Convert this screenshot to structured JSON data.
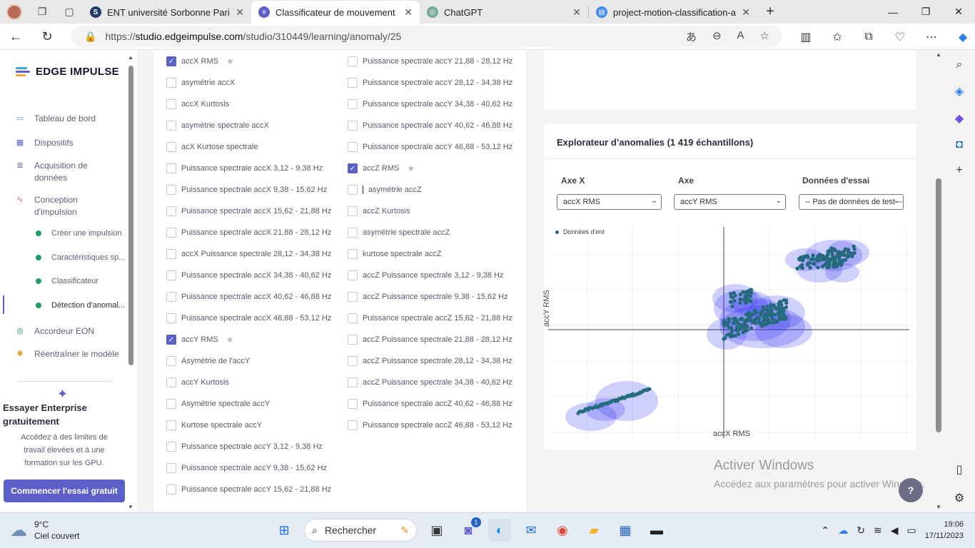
{
  "browser": {
    "tabs": [
      {
        "title": "ENT université Sorbonne Paris No",
        "favicon": "S",
        "color": "#1f3a66",
        "active": false
      },
      {
        "title": "Classificateur de mouvement ind",
        "favicon": "≡",
        "color": "#5b5fc7",
        "active": true
      },
      {
        "title": "ChatGPT",
        "favicon": "◎",
        "color": "#74aa9c",
        "active": false
      },
      {
        "title": "project-motion-classification-anc",
        "favicon": "▤",
        "color": "#4285f4",
        "active": false
      }
    ],
    "close_glyph": "✕",
    "new_tab_glyph": "+",
    "url_prefix": "https://",
    "url_host": "studio.edgeimpulse.com",
    "url_path": "/studio/310449/learning/anomaly/25"
  },
  "sidebar": {
    "brand": "EDGE IMPULSE",
    "nav": [
      {
        "label": "Tableau de bord",
        "icon": "monitor-icon",
        "glyph": "▭",
        "color": "#3aa6d8"
      },
      {
        "label": "Dispositifs",
        "icon": "chip-icon",
        "glyph": "▦",
        "color": "#5b5fc7"
      },
      {
        "label": "Acquisition de données",
        "icon": "database-icon",
        "glyph": "≣",
        "color": "#5b5fc7"
      },
      {
        "label": "Conception d'impulsion",
        "icon": "pulse-icon",
        "glyph": "∿",
        "color": "#e2554b"
      }
    ],
    "sub": [
      {
        "label": "Créer une impulsion"
      },
      {
        "label": "Caractéristiques sp..."
      },
      {
        "label": "Classificateur"
      },
      {
        "label": "Détection d'anomal..."
      }
    ],
    "nav2": [
      {
        "label": "Accordeur EON",
        "icon": "tuner-icon",
        "glyph": "◎",
        "color": "#1f9e63"
      },
      {
        "label": "Réentraîner le modèle",
        "icon": "retrain-icon",
        "glyph": "✱",
        "color": "#e0a020"
      }
    ],
    "enterprise_title": "Essayer Enterprise gratuitement",
    "enterprise_desc": "Accédez à des limites de travail élevées et à une formation sur les GPU.",
    "enterprise_button": "Commencer l'essai gratuit"
  },
  "features": {
    "left": [
      {
        "label": "accX RMS",
        "checked": true,
        "star": true
      },
      {
        "label": "asymétrie accX",
        "checked": false
      },
      {
        "label": "accX Kurtosis",
        "checked": false
      },
      {
        "label": "asymétrie spectrale accX",
        "checked": false
      },
      {
        "label": "acX Kurtose spectrale",
        "checked": false
      },
      {
        "label": "Puissance spectrale accX 3,12 - 9,38 Hz",
        "checked": false
      },
      {
        "label": "Puissance spectrale accX 9,38 - 15,62 Hz",
        "checked": false
      },
      {
        "label": "Puissance spectrale accX 15,62 - 21,88 Hz",
        "checked": false
      },
      {
        "label": "Puissance spectrale accX 21,88 - 28,12 Hz",
        "checked": false
      },
      {
        "label": "accX Puissance spectrale 28,12 - 34,38 Hz",
        "checked": false
      },
      {
        "label": "Puissance spectrale accX 34,38 - 40,62 Hz",
        "checked": false
      },
      {
        "label": "Puissance spectrale accX 40,62 - 46,88 Hz",
        "checked": false
      },
      {
        "label": "Puissance spectrale accX 46,88 - 53,12 Hz",
        "checked": false
      },
      {
        "label": "accY RMS",
        "checked": true,
        "star": true
      },
      {
        "label": "Asymétrie de l'accY",
        "checked": false
      },
      {
        "label": "accY Kurtosis",
        "checked": false
      },
      {
        "label": "Asymétrie spectrale accY",
        "checked": false
      },
      {
        "label": "Kurtose spectrale accY",
        "checked": false
      },
      {
        "label": "Puissance spectrale accY 3,12 - 9,38 Hz",
        "checked": false
      },
      {
        "label": "Puissance spectrale accY 9,38 - 15,62 Hz",
        "checked": false
      },
      {
        "label": "Puissance spectrale accY 15,62 - 21,88 Hz",
        "checked": false
      }
    ],
    "right": [
      {
        "label": "Puissance spectrale accY 21,88 - 28,12 Hz",
        "checked": false
      },
      {
        "label": "Puissance spectrale accY 28,12 - 34,38 Hz",
        "checked": false
      },
      {
        "label": "Puissance spectrale accY 34,38 - 40,62 Hz",
        "checked": false
      },
      {
        "label": "Puissance spectrale accY 40,62 - 46,88 Hz",
        "checked": false
      },
      {
        "label": "Puissance spectrale accY 46,88 - 53,12 Hz",
        "checked": false
      },
      {
        "label": "accZ RMS",
        "checked": true,
        "star": true
      },
      {
        "label": "asymétrie accZ",
        "checked": false,
        "caret": true
      },
      {
        "label": "accZ Kurtosis",
        "checked": false
      },
      {
        "label": "asymétrie spectrale accZ",
        "checked": false
      },
      {
        "label": "kurtose spectrale accZ",
        "checked": false
      },
      {
        "label": "accZ Puissance spectrale 3,12 - 9,38 Hz",
        "checked": false
      },
      {
        "label": "accZ Puissance spectrale 9,38 - 15,62 Hz",
        "checked": false
      },
      {
        "label": "Puissance spectrale accZ 15,62 - 21,88 Hz",
        "checked": false
      },
      {
        "label": "accZ Puissance spectrale 21,88 - 28,12 Hz",
        "checked": false
      },
      {
        "label": "accZ Puissance spectrale 28,12 - 34,38 Hz",
        "checked": false
      },
      {
        "label": "accZ Puissance spectrale 34,38 - 40,62 Hz",
        "checked": false
      },
      {
        "label": "Puissance spectrale accZ 40,62 - 46,88 Hz",
        "checked": false
      },
      {
        "label": "Puissance spectrale accZ 46,88 - 53,12 Hz",
        "checked": false
      }
    ]
  },
  "explorer": {
    "title": "Explorateur d’anomalies (1 419 échantillons)",
    "x_axis_label": "Axe X",
    "y_axis_label": "Axe",
    "test_label": "Données d'essai",
    "x_axis_value": "accX RMS",
    "y_axis_value": "accY RMS",
    "test_value": "-- Pas de données de test --",
    "legend": "Données d'ent",
    "x_title": "accX RMS",
    "y_title": "accY RMS",
    "point_color": "#2c5f86",
    "cluster_color": "#2a2bf0"
  },
  "watermark": {
    "line1": "Activer Windows",
    "line2": "Accédez aux paramètres pour activer Windows."
  },
  "help_glyph": "?",
  "taskbar": {
    "temp": "9°C",
    "weather": "Ciel couvert",
    "search": "Rechercher",
    "time": "19:06",
    "date": "17/11/2023",
    "badge": "1"
  }
}
